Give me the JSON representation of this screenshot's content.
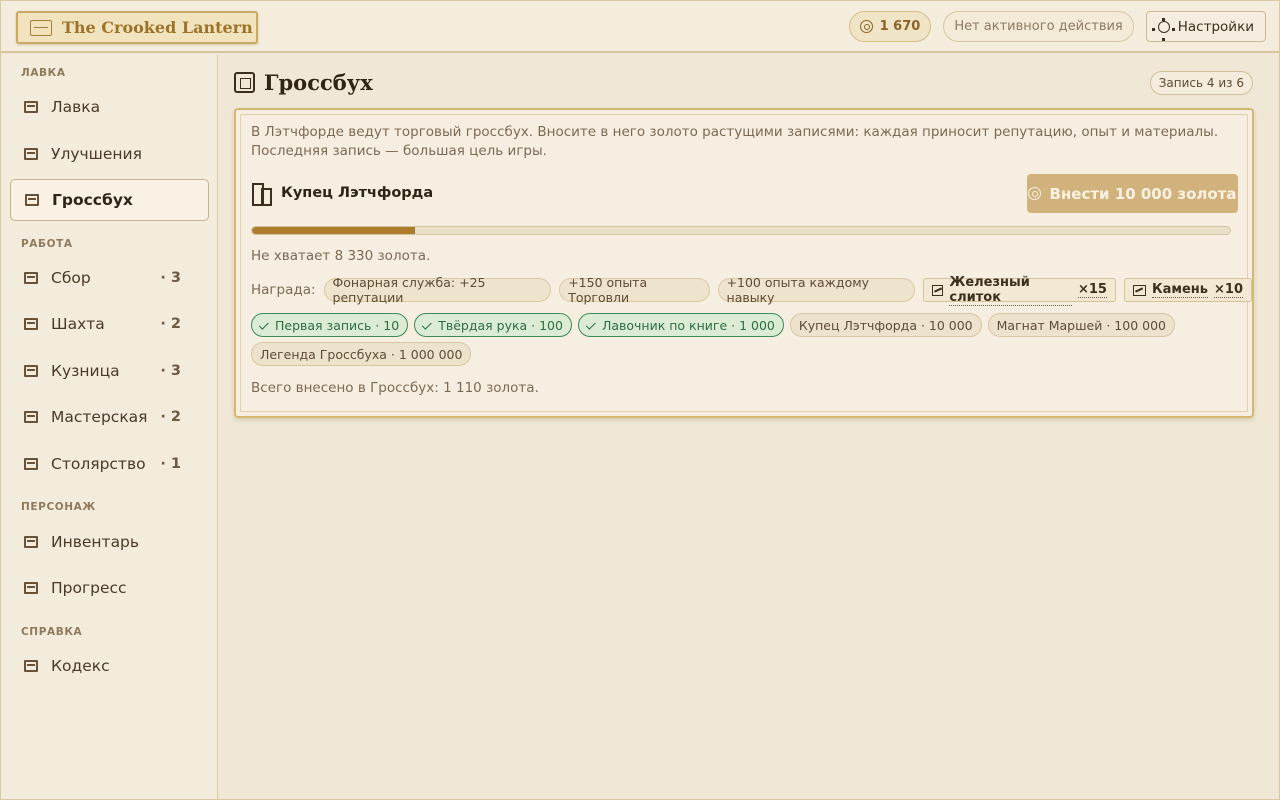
{
  "header": {
    "brand": "The Crooked Lantern",
    "gold": "1 670",
    "activity": "Нет активного действия",
    "settings_label": "Настройки"
  },
  "sidebar": {
    "sections": [
      {
        "label": "ЛАВКА"
      },
      {
        "label": "РАБОТА"
      },
      {
        "label": "ПЕРСОНАЖ"
      },
      {
        "label": "СПРАВКА"
      }
    ],
    "items": [
      {
        "label": "Лавка",
        "count": ""
      },
      {
        "label": "Улучшения",
        "count": ""
      },
      {
        "label": "Гроссбух",
        "count": ""
      },
      {
        "label": "Сбор",
        "count": "· 3"
      },
      {
        "label": "Шахта",
        "count": "· 2"
      },
      {
        "label": "Кузница",
        "count": "· 3"
      },
      {
        "label": "Мастерская",
        "count": "· 2"
      },
      {
        "label": "Столярство",
        "count": "· 1"
      },
      {
        "label": "Инвентарь",
        "count": ""
      },
      {
        "label": "Прогресс",
        "count": ""
      },
      {
        "label": "Кодекс",
        "count": ""
      }
    ]
  },
  "page": {
    "title": "Гроссбух",
    "entry": "Запись 4 из 6",
    "description": "В Лэтчфорде ведут торговый гроссбух. Вносите в него золото растущими записями: каждая приносит репутацию, опыт и материалы. Последняя запись — большая цель игры.",
    "goal_name": "Купец Лэтчфорда",
    "deposit_label": "Внести 10 000 золота",
    "progress_percent": 16.7,
    "shortfall": "Не хватает 8 330 золота.",
    "reward_label": "Награда:",
    "rewards": [
      "Фонарная служба: +25 репутации",
      "+150 опыта Торговли",
      "+100 опыта каждому навыку"
    ],
    "items": [
      {
        "name": "Железный слиток",
        "qty": "×15"
      },
      {
        "name": "Камень",
        "qty": "×10"
      }
    ],
    "milestones": [
      {
        "label": "Первая запись · 10",
        "done": true
      },
      {
        "label": "Твёрдая рука · 100",
        "done": true
      },
      {
        "label": "Лавочник по книге · 1 000",
        "done": true
      },
      {
        "label": "Купец Лэтчфорда · 10 000",
        "done": false
      },
      {
        "label": "Магнат Маршей · 100 000",
        "done": false
      },
      {
        "label": "Легенда Гроссбуха · 1 000 000",
        "done": false
      }
    ],
    "total": "Всего внесено в Гроссбух: 1 110 золота."
  }
}
